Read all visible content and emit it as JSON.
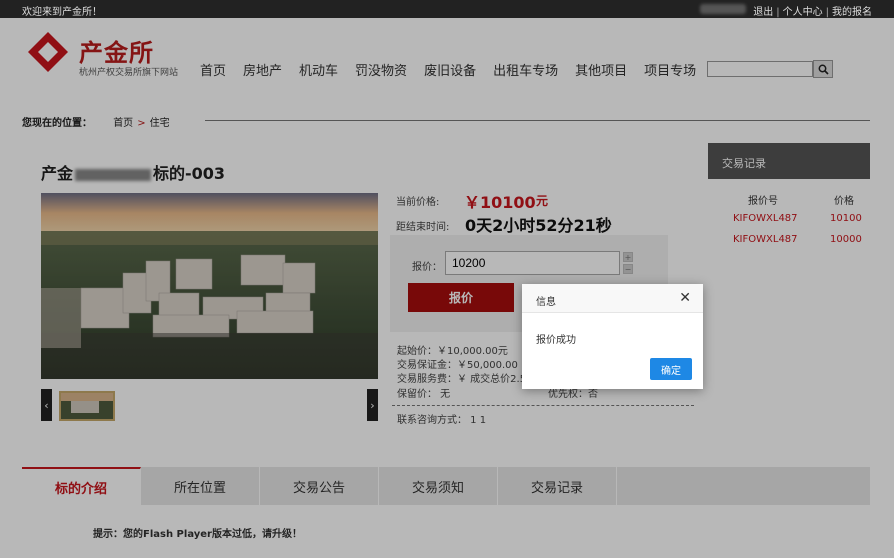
{
  "topbar": {
    "welcome": "欢迎来到产金所！",
    "links": [
      "退出",
      "个人中心",
      "我的报名"
    ]
  },
  "logo": {
    "title": "产金所",
    "subtitle": "杭州产权交易所旗下网站"
  },
  "nav": [
    "首页",
    "房地产",
    "机动车",
    "罚没物资",
    "废旧设备",
    "出租车专场",
    "其他项目",
    "项目专场"
  ],
  "search": {
    "value": ""
  },
  "breadcrumb": {
    "label": "您现在的位置：",
    "items": [
      "首页",
      "住宅"
    ],
    "separator": ">"
  },
  "listing": {
    "title_prefix": "产金",
    "title_suffix": "标的-003",
    "current_price_label": "当前价格:",
    "current_price": "￥10100",
    "price_unit": "元",
    "countdown_label": "距结束时间:",
    "countdown": "0天2小时52分21秒",
    "bid_label": "报价：",
    "bid_value": "10200",
    "bid_button": "报价",
    "info": {
      "start_price": "起始价：￥10,000.00元",
      "deposit": "交易保证金：￥50,000.00",
      "service_fee": "交易服务费：￥ 成交总价2.5",
      "reserve": "保留价： 无",
      "priority": "优先权：否",
      "contact": "联系咨询方式： 1 1"
    }
  },
  "records": {
    "title": "交易记录",
    "columns": [
      "报价号",
      "价格"
    ],
    "rows": [
      {
        "id": "KIFOWXL487",
        "price": "10100"
      },
      {
        "id": "KIFOWXL487",
        "price": "10000"
      }
    ]
  },
  "tabs": [
    "标的介绍",
    "所在位置",
    "交易公告",
    "交易须知",
    "交易记录"
  ],
  "flash_note": "提示：您的Flash Player版本过低，请升级！",
  "dialog": {
    "title": "信息",
    "message": "报价成功",
    "ok": "确定"
  },
  "colors": {
    "brand_red": "#c8161d",
    "button_red": "#a70d0d",
    "dialog_blue": "#1e88e5"
  }
}
